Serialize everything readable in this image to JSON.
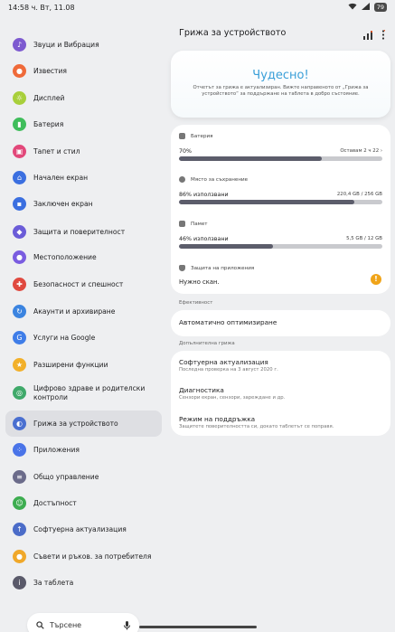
{
  "status_bar": {
    "time": "14:58 ч.  Вт, 11.08",
    "battery": "79"
  },
  "sidebar": {
    "items": [
      {
        "label": "Звуци и Вибрация",
        "icon": "sound-icon",
        "color": "#7d5ad0"
      },
      {
        "label": "Известия",
        "icon": "notification-icon",
        "color": "#ef6a3a"
      },
      {
        "label": "Дисплей",
        "icon": "display-icon",
        "color": "#a8cf3b"
      },
      {
        "label": "Батерия",
        "icon": "battery-icon",
        "color": "#3fbd5b"
      },
      {
        "label": "Тапет и стил",
        "icon": "wallpaper-icon",
        "color": "#e2487a"
      },
      {
        "label": "Начален екран",
        "icon": "home-icon",
        "color": "#3b6fe0"
      },
      {
        "label": "Заключен екран",
        "icon": "lock-icon",
        "color": "#3b6fe0"
      },
      {
        "label": "Защита и поверителност",
        "icon": "shield-icon",
        "color": "#6b5cd8"
      },
      {
        "label": "Местоположение",
        "icon": "location-icon",
        "color": "#7a5ce0"
      },
      {
        "label": "Безопасност и спешност",
        "icon": "emergency-icon",
        "color": "#e0493f"
      },
      {
        "label": "Акаунти и архивиране",
        "icon": "sync-icon",
        "color": "#3b84e0"
      },
      {
        "label": "Услуги на Google",
        "icon": "google-icon",
        "color": "#3f7de8"
      },
      {
        "label": "Разширени функции",
        "icon": "star-icon",
        "color": "#f2b02a"
      },
      {
        "label": "Цифрово здраве и родителски контроли",
        "icon": "wellbeing-icon",
        "color": "#3fa96a"
      },
      {
        "label": "Грижа за устройството",
        "icon": "device-care-icon",
        "color": "#4a6fd0",
        "active": true
      },
      {
        "label": "Приложения",
        "icon": "apps-icon",
        "color": "#4a74e8"
      },
      {
        "label": "Общо управление",
        "icon": "sliders-icon",
        "color": "#6b6b8a"
      },
      {
        "label": "Достъпност",
        "icon": "accessibility-icon",
        "color": "#3dad50"
      },
      {
        "label": "Софтуерна актуализация",
        "icon": "update-icon",
        "color": "#4b6cc8"
      },
      {
        "label": "Съвети и ръков. за потребителя",
        "icon": "tips-icon",
        "color": "#f0a82a"
      },
      {
        "label": "За таблета",
        "icon": "info-icon",
        "color": "#5a5a6a"
      }
    ]
  },
  "search": {
    "label": "Търсене"
  },
  "main": {
    "title": "Грижа за устройството",
    "hero": {
      "headline": "Чудесно!",
      "description": "Отчетът за грижа е актуализиран. Вижте направеното от „Грижа за устройството“ за поддържане на таблета в добро състояние."
    },
    "battery": {
      "label": "Батерия",
      "value": "70%",
      "right": "Оставам 2 ч 22 ›",
      "fill": 0.7
    },
    "storage": {
      "label": "Място за съхранение",
      "value": "86% използвани",
      "right": "220,4 GB / 256 GB",
      "fill": 0.86
    },
    "memory": {
      "label": "Памет",
      "value": "46% използвани",
      "right": "5,5 GB / 12 GB",
      "fill": 0.46
    },
    "app_protection": {
      "label": "Защита на приложения",
      "value": "Нужно скан."
    },
    "efficiency_label": "Ефективност",
    "auto_optimize": "Автоматично оптимизиране",
    "extra_label": "Допълнителна грижа",
    "list": [
      {
        "title": "Софтуерна актуализация",
        "subtitle": "Последна проверка на 3 август 2020 г."
      },
      {
        "title": "Диагностика",
        "subtitle": "Сензори екран, сензори, зареждане и др."
      },
      {
        "title": "Режим на поддръжка",
        "subtitle": "Защитете поверителността си, докато таблетът се поправя."
      }
    ]
  }
}
